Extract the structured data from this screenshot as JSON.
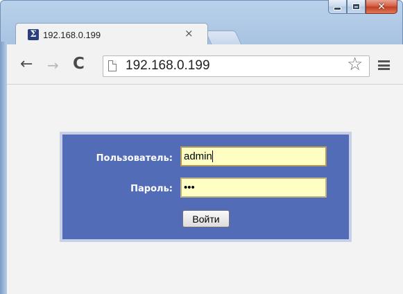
{
  "window": {
    "caption_buttons": [
      "minimize",
      "maximize",
      "close"
    ]
  },
  "tab": {
    "title": "192.168.0.199",
    "favicon_glyph": "Σ",
    "close_glyph": "×"
  },
  "toolbar": {
    "url": "192.168.0.199",
    "back_glyph": "←",
    "forward_glyph": "→",
    "reload_glyph": "C",
    "star_glyph": "☆"
  },
  "login": {
    "user_label": "Пользователь:",
    "user_value": "admin",
    "password_label": "Пароль:",
    "password_value": "•••",
    "submit_label": "Войти"
  },
  "colors": {
    "panel": "#526cb8",
    "panel_border": "#c8d0e8",
    "field_bg": "#ffffc4",
    "page_bg": "#f3f3f3"
  }
}
